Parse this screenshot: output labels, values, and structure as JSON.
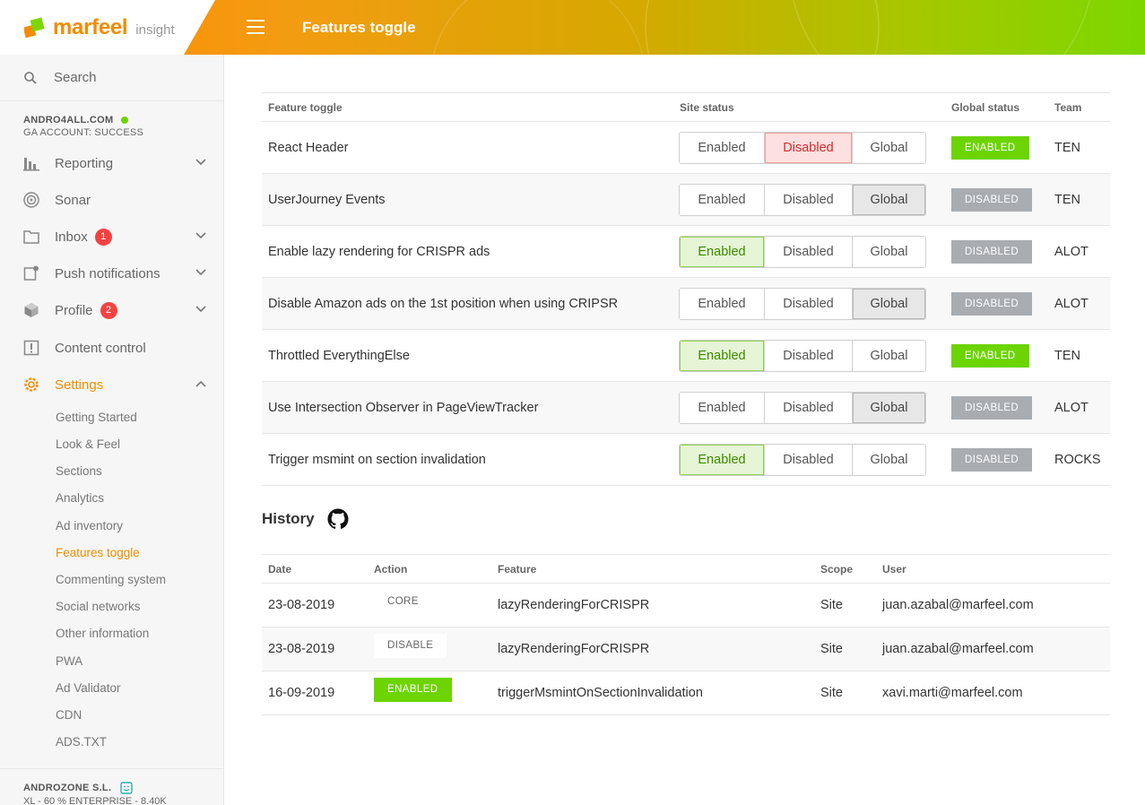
{
  "header": {
    "logo_name": "marfeel",
    "logo_sub": "insight",
    "page_title": "Features toggle"
  },
  "colors": {
    "accent": "#f28c00",
    "enabled_green": "#6cd400",
    "disabled_gray": "#a9acb0",
    "badge_red": "#f44242"
  },
  "sidebar": {
    "search_placeholder": "Search",
    "account_name": "ANDRO4ALL.COM",
    "account_sub": "GA ACCOUNT: SUCCESS",
    "items": [
      {
        "label": "Reporting",
        "icon": "bar-chart-icon"
      },
      {
        "label": "Sonar",
        "icon": "sonar-icon"
      },
      {
        "label": "Inbox",
        "icon": "folder-icon",
        "badge": "1"
      },
      {
        "label": "Push notifications",
        "icon": "push-notification-icon"
      },
      {
        "label": "Profile",
        "icon": "cube-icon",
        "badge": "2"
      },
      {
        "label": "Content control",
        "icon": "alert-box-icon"
      },
      {
        "label": "Settings",
        "icon": "gear-icon"
      }
    ],
    "settings_sub": [
      "Getting Started",
      "Look & Feel",
      "Sections",
      "Analytics",
      "Ad inventory",
      "Features toggle",
      "Commenting system",
      "Social networks",
      "Other information",
      "PWA",
      "Ad Validator",
      "CDN",
      "ADS.TXT"
    ],
    "footer_name": "ANDROZONE S.L.",
    "footer_sub": "XL - 60 % ENTERPRISE - 8.40K"
  },
  "features": {
    "headers": {
      "feature": "Feature toggle",
      "site": "Site status",
      "global": "Global status",
      "team": "Team"
    },
    "options": [
      "Enabled",
      "Disabled",
      "Global"
    ],
    "rows": [
      {
        "name": "React Header",
        "selected": "Disabled",
        "global": "ENABLED",
        "team": "TEN"
      },
      {
        "name": "UserJourney Events",
        "selected": "Global",
        "global": "DISABLED",
        "team": "TEN"
      },
      {
        "name": "Enable lazy rendering for CRISPR ads",
        "selected": "Enabled",
        "global": "DISABLED",
        "team": "ALOT"
      },
      {
        "name": "Disable Amazon ads on the 1st position when using CRIPSR",
        "selected": "Global",
        "global": "DISABLED",
        "team": "ALOT"
      },
      {
        "name": "Throttled EverythingElse",
        "selected": "Enabled",
        "global": "ENABLED",
        "team": "TEN"
      },
      {
        "name": "Use Intersection Observer in PageViewTracker",
        "selected": "Global",
        "global": "DISABLED",
        "team": "ALOT"
      },
      {
        "name": "Trigger msmint on section invalidation",
        "selected": "Enabled",
        "global": "DISABLED",
        "team": "ROCKS"
      }
    ]
  },
  "history": {
    "title": "History",
    "headers": {
      "date": "Date",
      "action": "Action",
      "feature": "Feature",
      "scope": "Scope",
      "user": "User"
    },
    "rows": [
      {
        "date": "23-08-2019",
        "action": "CORE",
        "feature": "lazyRenderingForCRISPR",
        "scope": "Site",
        "user": "juan.azabal@marfeel.com"
      },
      {
        "date": "23-08-2019",
        "action": "DISABLE",
        "feature": "lazyRenderingForCRISPR",
        "scope": "Site",
        "user": "juan.azabal@marfeel.com"
      },
      {
        "date": "16-09-2019",
        "action": "ENABLED",
        "feature": "triggerMsmintOnSectionInvalidation",
        "scope": "Site",
        "user": "xavi.marti@marfeel.com"
      }
    ]
  }
}
